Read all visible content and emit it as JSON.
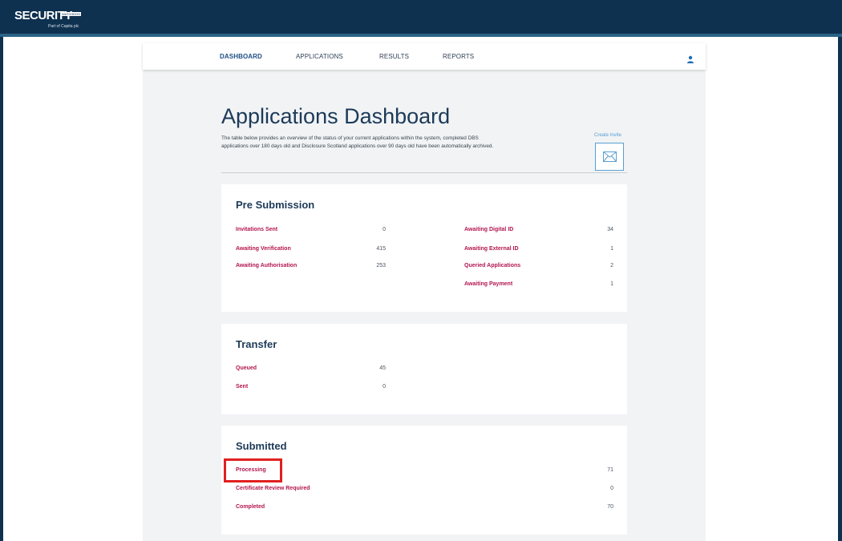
{
  "brand": {
    "logo_main": "SECURITY",
    "logo_badge": "WATCHDOG",
    "logo_tagline": "Part of Capita plc"
  },
  "nav": {
    "items": [
      {
        "label": "DASHBOARD"
      },
      {
        "label": "APPLICATIONS"
      },
      {
        "label": "RESULTS"
      },
      {
        "label": "REPORTS"
      }
    ],
    "user_icon": "user-icon"
  },
  "page": {
    "title": "Applications Dashboard",
    "intro": "The table below provides an overview of the status of your current applications within the system, completed DBS applications over 180 days old and Disclosure Scotland applications over 90 days old have been automatically archived.",
    "create_invite_label": "Create Invite",
    "create_invite_icon": "envelope-icon"
  },
  "pre_submission": {
    "title": "Pre Submission",
    "left": [
      {
        "label": "Invitations Sent",
        "value": "0"
      },
      {
        "label": "Awaiting Verification",
        "value": "415"
      },
      {
        "label": "Awaiting Authorisation",
        "value": "253"
      }
    ],
    "right": [
      {
        "label": "Awaiting Digital ID",
        "value": "34"
      },
      {
        "label": "Awaiting External ID",
        "value": "1"
      },
      {
        "label": "Queried Applications",
        "value": "2"
      },
      {
        "label": "Awaiting Payment",
        "value": "1"
      }
    ]
  },
  "transfer": {
    "title": "Transfer",
    "rows": [
      {
        "label": "Queued",
        "value": "45"
      },
      {
        "label": "Sent",
        "value": "0"
      }
    ]
  },
  "submitted": {
    "title": "Submitted",
    "rows": [
      {
        "label": "Processing",
        "value": "71"
      },
      {
        "label": "Certificate Review Required",
        "value": "0"
      },
      {
        "label": "Completed",
        "value": "70"
      }
    ]
  },
  "colors": {
    "header": "#0f3150",
    "link": "#b3164f",
    "title": "#1d3a58",
    "accent": "#5a9fd1",
    "highlight": "#e02020"
  }
}
